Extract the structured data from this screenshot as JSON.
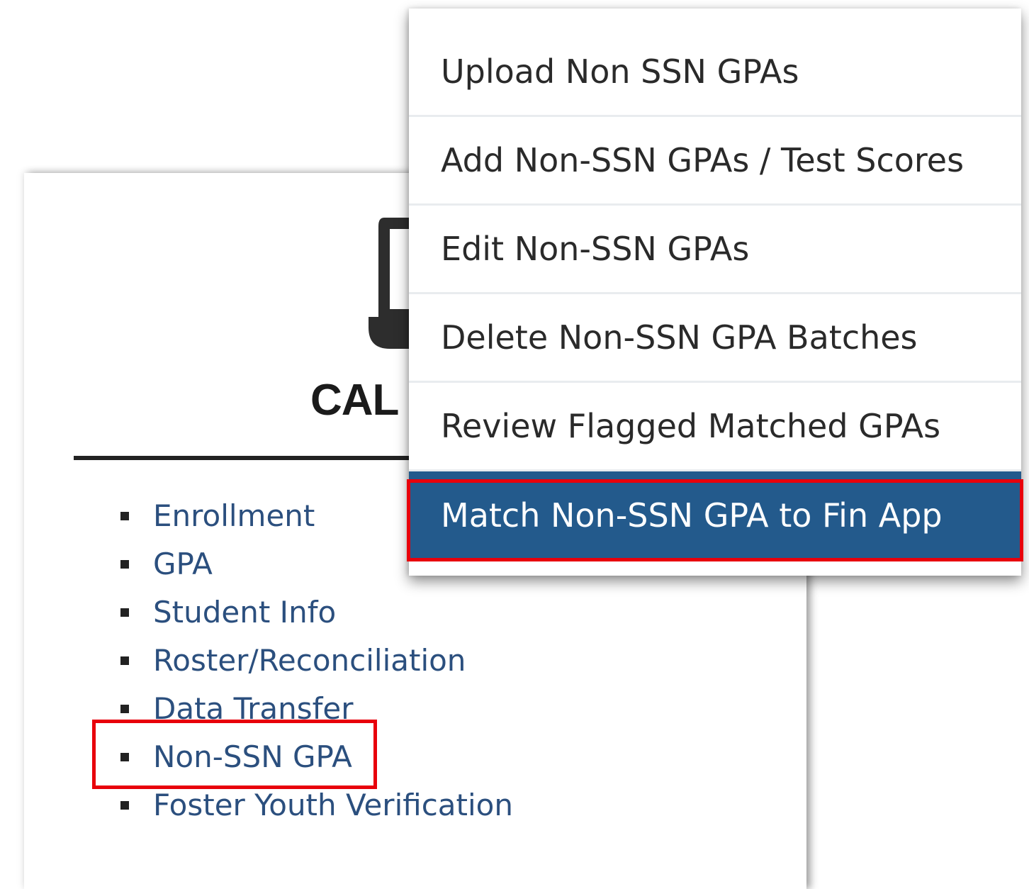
{
  "card": {
    "title": "CAL"
  },
  "nav": {
    "items": [
      {
        "label": "Enrollment"
      },
      {
        "label": "GPA"
      },
      {
        "label": "Student Info"
      },
      {
        "label": "Roster/Reconciliation"
      },
      {
        "label": "Data Transfer"
      },
      {
        "label": "Non-SSN GPA"
      },
      {
        "label": "Foster Youth Verification"
      }
    ]
  },
  "dropdown": {
    "items": [
      {
        "label": "Upload Non SSN GPAs"
      },
      {
        "label": "Add Non-SSN GPAs / Test Scores"
      },
      {
        "label": "Edit Non-SSN GPAs"
      },
      {
        "label": "Delete Non-SSN GPA Batches"
      },
      {
        "label": "Review Flagged Matched GPAs"
      },
      {
        "label": "Match Non-SSN GPA to Fin App"
      }
    ]
  },
  "colors": {
    "link": "#2b4f7e",
    "menu_active_bg": "#235a8c",
    "highlight": "#e8000b"
  }
}
